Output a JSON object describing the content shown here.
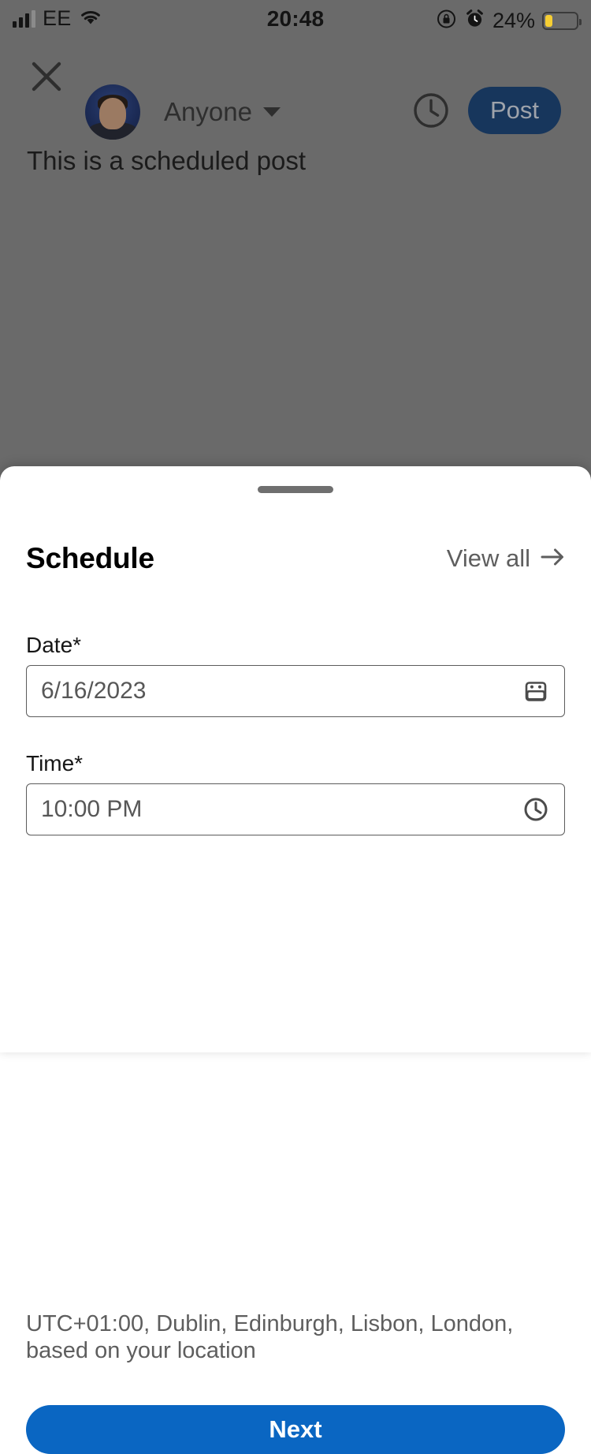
{
  "status_bar": {
    "carrier": "EE",
    "time": "20:48",
    "battery_percent": "24%",
    "battery_level": 24,
    "icons": [
      "signal-bars-icon",
      "wifi-icon",
      "rotation-lock-icon",
      "alarm-icon",
      "battery-icon"
    ]
  },
  "composer": {
    "close_label": "close-icon",
    "audience": "Anyone",
    "clock_label": "clock-icon",
    "post_button": "Post",
    "post_body": "This is a scheduled post"
  },
  "sheet": {
    "title": "Schedule",
    "view_all": "View all",
    "date": {
      "label": "Date*",
      "value": "6/16/2023",
      "placeholder": "6/16/2023",
      "icon": "calendar-icon"
    },
    "time": {
      "label": "Time*",
      "value": "10:00 PM",
      "placeholder": "10:00 PM",
      "icon": "clock-icon"
    },
    "timezone_note": "UTC+01:00, Dublin, Edinburgh, Lisbon, London, based on your location",
    "next_button": "Next"
  },
  "colors": {
    "accent": "#0a66c2",
    "post_button": "#17365c",
    "backdrop": "#6a6a6a",
    "battery": "#f6ce33",
    "field_border": "#5c5c5c"
  }
}
